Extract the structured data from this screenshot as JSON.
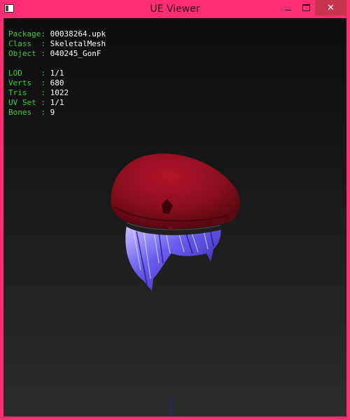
{
  "window": {
    "title": "UE Viewer",
    "minimize_glyph": "minimize-icon",
    "maximize_glyph": "maximize-icon",
    "close_glyph": "✕"
  },
  "info": {
    "package_label": "Package:",
    "package_value": "00038264.upk",
    "class_label": "Class  :",
    "class_value": "SkeletalMesh",
    "object_label": "Object :",
    "object_value": "040245_GonF",
    "lod_label": "LOD    :",
    "lod_value": "1/1",
    "verts_label": "Verts  :",
    "verts_value": "680",
    "tris_label": "Tris   :",
    "tris_value": "1022",
    "uvset_label": "UV Set :",
    "uvset_value": "1/1",
    "bones_label": "Bones  :",
    "bones_value": "9"
  },
  "colors": {
    "frame": "#ff2d72",
    "label_green": "#3ad03a",
    "beret_red": "#8a0f1e",
    "hair_blue": "#5a4be0",
    "axis_blue": "#1a20c8"
  }
}
